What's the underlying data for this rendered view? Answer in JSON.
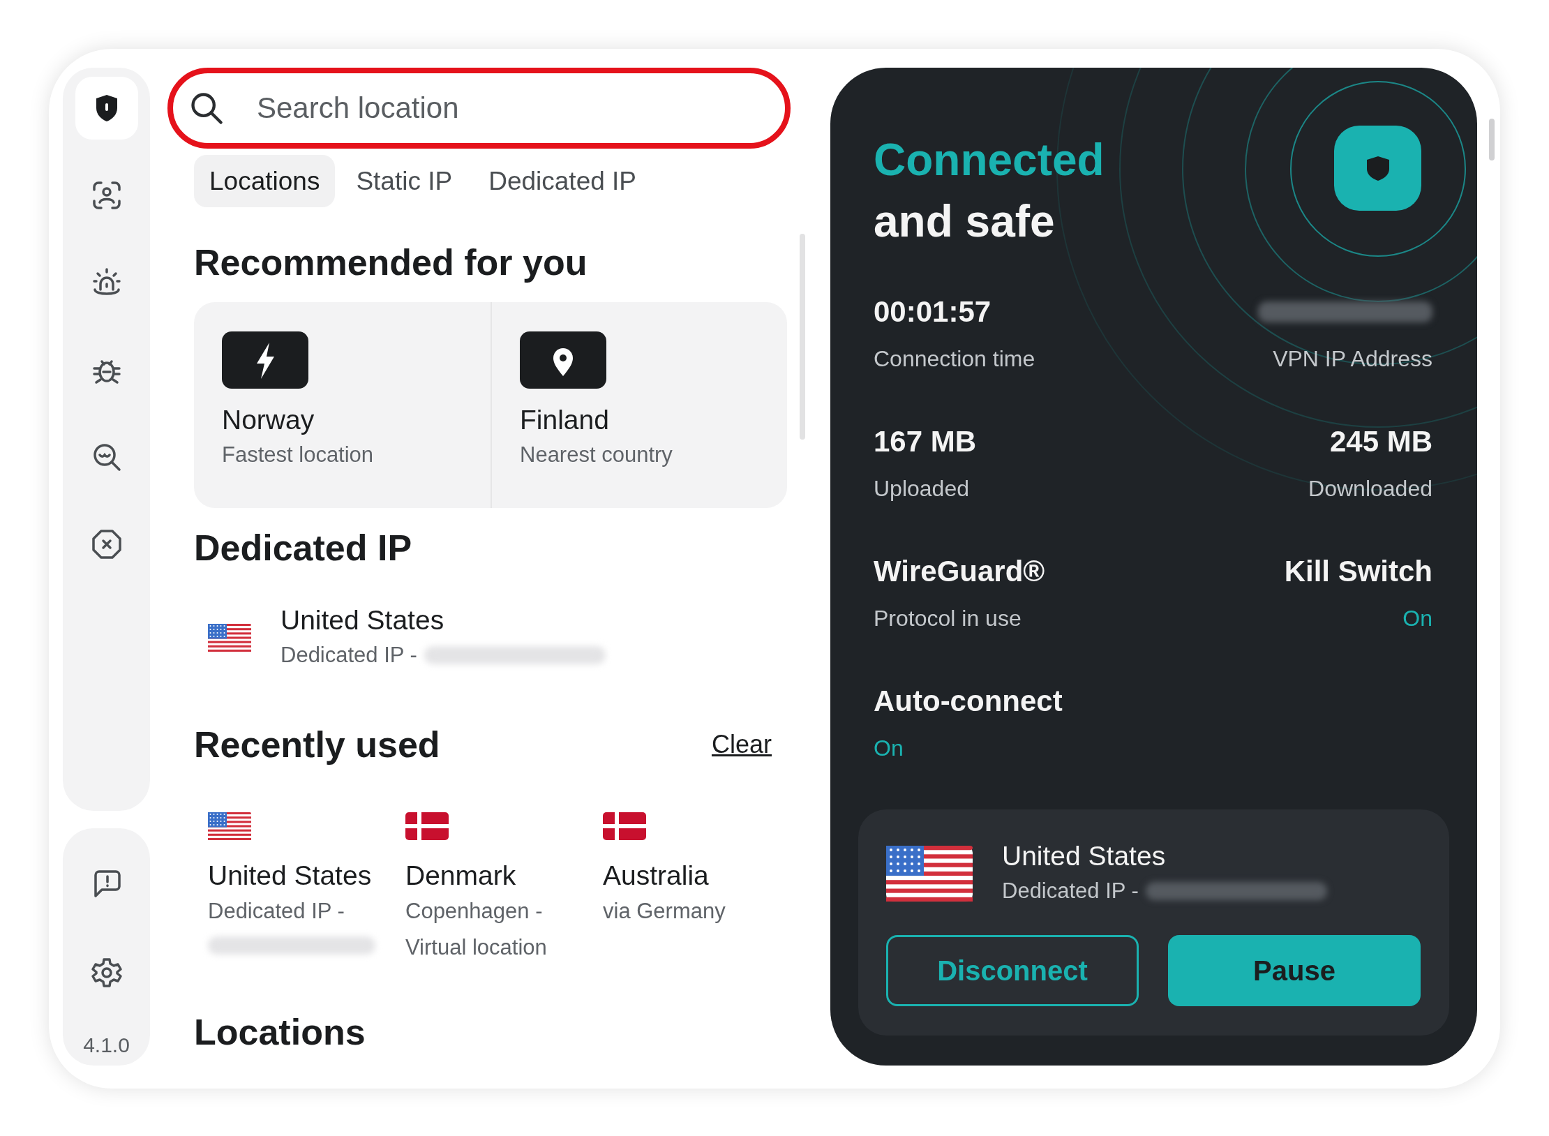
{
  "sidebar": {
    "items": [
      {
        "selected": true
      },
      {
        "selected": false
      },
      {
        "selected": false
      },
      {
        "selected": false
      },
      {
        "selected": false
      },
      {
        "selected": false
      }
    ],
    "footer_items": [
      {
        "selected": false
      },
      {
        "selected": false
      }
    ],
    "version": "4.1.0"
  },
  "search": {
    "placeholder": "Search location"
  },
  "tabs": [
    {
      "label": "Locations",
      "selected": true
    },
    {
      "label": "Static IP",
      "selected": false
    },
    {
      "label": "Dedicated IP",
      "selected": false
    }
  ],
  "recommended": {
    "heading": "Recommended for you",
    "items": [
      {
        "kind": "fastest",
        "title": "Norway",
        "subtitle": "Fastest location"
      },
      {
        "kind": "nearest",
        "title": "Finland",
        "subtitle": "Nearest country"
      }
    ]
  },
  "dedicated_ip": {
    "heading": "Dedicated IP",
    "items": [
      {
        "kind": "us",
        "country": "United States",
        "detail": "Dedicated IP -",
        "redacted": true
      }
    ]
  },
  "recently_used": {
    "heading": "Recently used",
    "clear": "Clear",
    "items": [
      {
        "kind": "us",
        "country": "United States",
        "detail": "Dedicated IP -",
        "redacted": true
      },
      {
        "kind": "dk",
        "country": "Denmark",
        "detail": "Copenhagen - Virtual location"
      },
      {
        "kind": "dk",
        "country": "Australia",
        "detail": "via Germany"
      }
    ]
  },
  "locations": {
    "heading": "Locations"
  },
  "status": {
    "title": "Connected",
    "subtitle": "and safe",
    "rows": [
      [
        {
          "value": "00:01:57",
          "label": "Connection time",
          "accent": false
        },
        {
          "label": "VPN IP Address",
          "accent": false,
          "redacted": true
        }
      ],
      [
        {
          "value": "167 MB",
          "label": "Uploaded",
          "accent": false
        },
        {
          "value": "245 MB",
          "label": "Downloaded",
          "accent": false
        }
      ],
      [
        {
          "value": "WireGuard®",
          "label": "Protocol in use",
          "accent": false
        },
        {
          "value": "Kill Switch",
          "label": "On",
          "accent": true
        }
      ],
      [
        {
          "value": "Auto-connect",
          "label": "On",
          "accent": true
        }
      ]
    ],
    "current": {
      "kind": "us",
      "country": "United States",
      "detail": "Dedicated IP -",
      "redacted": true
    },
    "buttons": [
      {
        "label": "Disconnect",
        "kind": "outline"
      },
      {
        "label": "Pause",
        "kind": "filled"
      }
    ]
  }
}
